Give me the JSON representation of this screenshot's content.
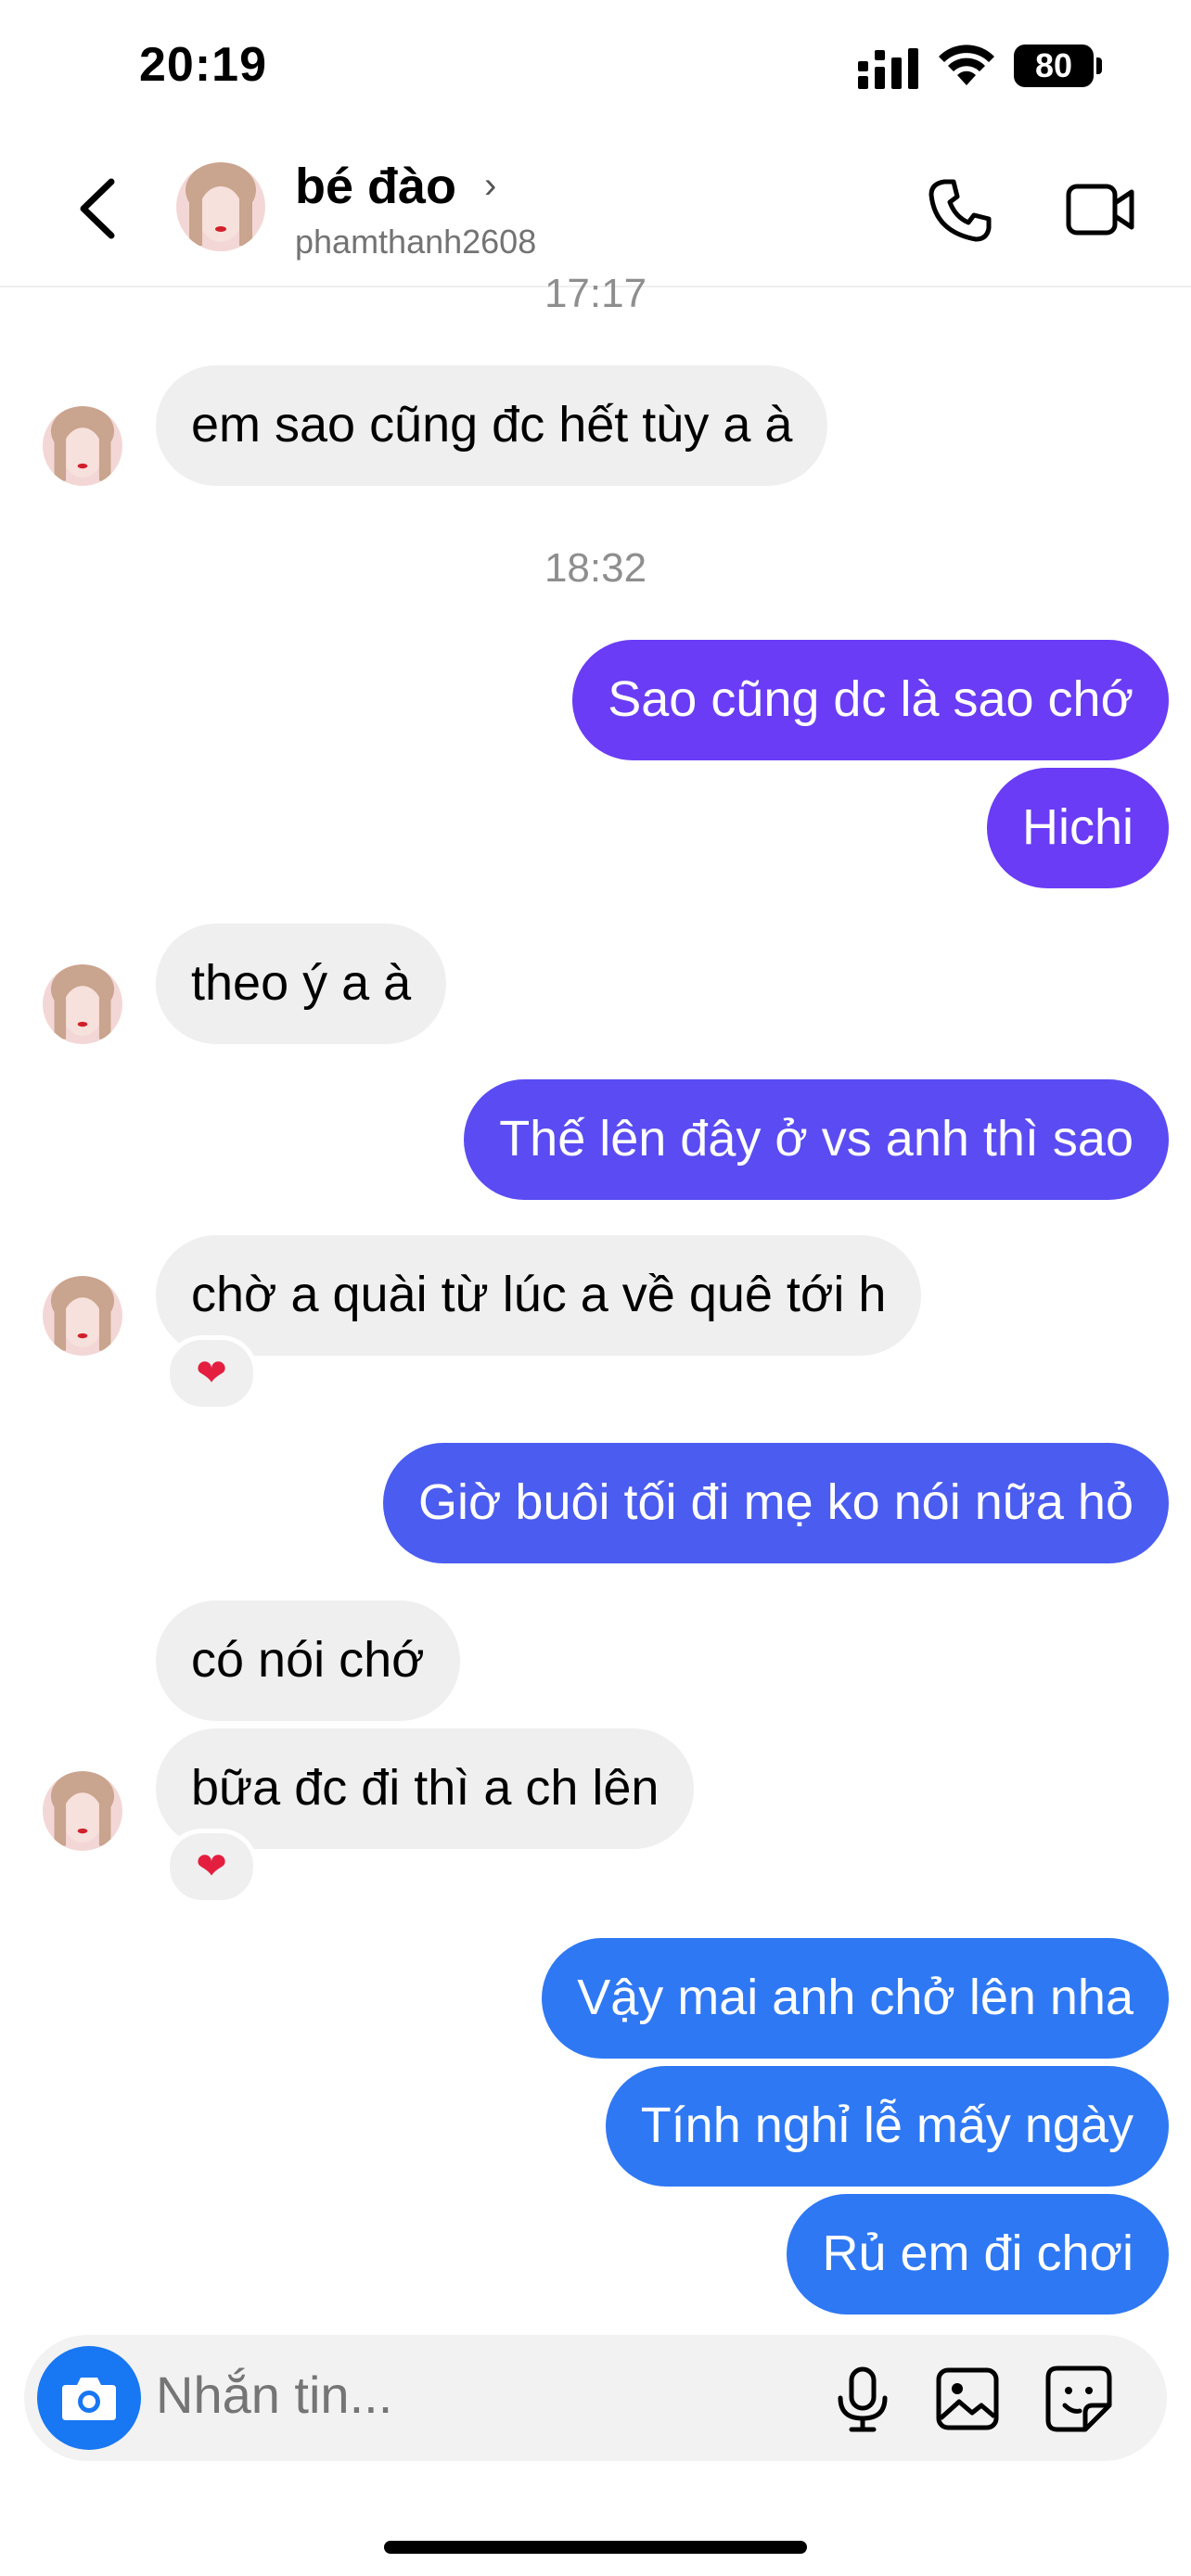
{
  "status_bar": {
    "time": "20:19",
    "battery": "80"
  },
  "header": {
    "name": "bé đào",
    "chevron": "›",
    "username": "phamthanh2608"
  },
  "colors": {
    "purple": "#6a3cf5",
    "blue_violet": "#4b5cf0",
    "blue": "#2f78f4",
    "incoming": "#efefef"
  },
  "timestamps": [
    "17:17",
    "18:32"
  ],
  "messages": [
    {
      "side": "in",
      "text": "em sao cũng đc hết tùy a à"
    },
    {
      "side": "out",
      "text": "Sao cũng dc là sao chớ"
    },
    {
      "side": "out",
      "text": "Hichi"
    },
    {
      "side": "in",
      "text": "theo ý a à"
    },
    {
      "side": "out",
      "text": "Thế lên đây ở vs anh thì sao"
    },
    {
      "side": "in",
      "text": "chờ a quài từ lúc a về quê tới h",
      "reaction": "❤"
    },
    {
      "side": "out",
      "text": "Giờ buôi tối đi mẹ ko nói nữa hỏ"
    },
    {
      "side": "in",
      "text": "có nói chớ"
    },
    {
      "side": "in",
      "text": "bữa đc đi thì a ch lên",
      "reaction": "❤"
    },
    {
      "side": "out",
      "text": "Vậy mai anh chở lên nha"
    },
    {
      "side": "out",
      "text": "Tính nghỉ lễ mấy ngày"
    },
    {
      "side": "out",
      "text": "Rủ em đi chơi"
    }
  ],
  "composer": {
    "placeholder": "Nhắn tin..."
  },
  "icons": [
    "back-chevron-icon",
    "phone-icon",
    "video-camera-icon",
    "camera-icon",
    "microphone-icon",
    "gallery-icon",
    "sticker-icon"
  ]
}
